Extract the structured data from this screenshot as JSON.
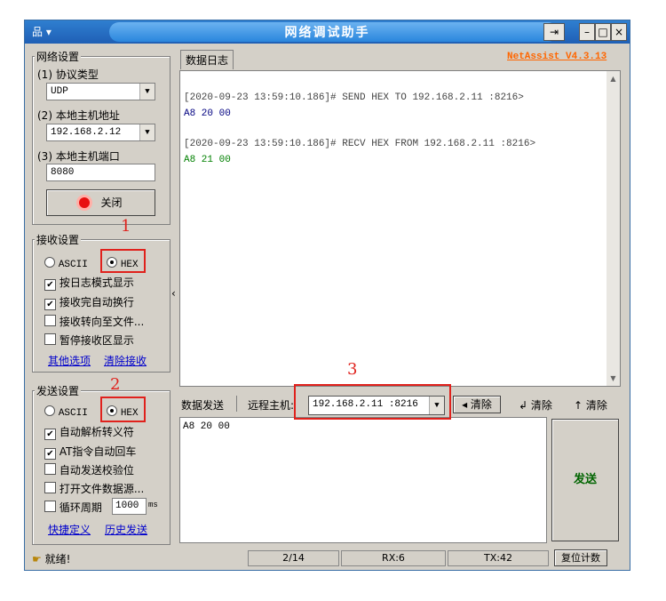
{
  "window": {
    "title": "网络调试助手",
    "version": "NetAssist V4.3.13",
    "menu_glyph": "品 ▾",
    "pin_glyph": "⇥",
    "minimize": "–",
    "maximize": "□",
    "close": "×"
  },
  "net_settings": {
    "group_label": "网络设置",
    "protocol_label": "(1) 协议类型",
    "protocol_value": "UDP",
    "host_label": "(2) 本地主机地址",
    "host_value": "192.168.2.12",
    "port_label": "(3) 本地主机端口",
    "port_value": "8080",
    "close_button": "关闭"
  },
  "recv_settings": {
    "group_label": "接收设置",
    "ascii_label": "ASCII",
    "hex_label": "HEX",
    "options": [
      "按日志模式显示",
      "接收完自动换行",
      "接收转向至文件...",
      "暂停接收区显示"
    ],
    "options_checked": [
      true,
      true,
      false,
      false
    ],
    "link_more": "其他选项",
    "link_clear": "清除接收"
  },
  "send_settings": {
    "group_label": "发送设置",
    "ascii_label": "ASCII",
    "hex_label": "HEX",
    "options": [
      "自动解析转义符",
      "AT指令自动回车",
      "自动发送校验位",
      "打开文件数据源...",
      "循环周期"
    ],
    "options_checked": [
      true,
      true,
      false,
      false,
      false
    ],
    "cycle_value": "1000",
    "cycle_unit": "ms",
    "link_shortcut": "快捷定义",
    "link_history": "历史发送"
  },
  "log": {
    "tab_label": "数据日志",
    "entries": [
      {
        "header": "[2020-09-23 13:59:10.186]# SEND HEX TO 192.168.2.11 :8216>",
        "data": "A8 20 00"
      },
      {
        "header": "[2020-09-23 13:59:10.186]# RECV HEX FROM 192.168.2.11 :8216>",
        "data": "A8 21 00"
      }
    ]
  },
  "send_bar": {
    "tab_label": "数据发送",
    "remote_label": "远程主机:",
    "remote_value": "192.168.2.11 :8216",
    "clear1": "清除",
    "clear2": "清除",
    "clear3": "清除",
    "send_text": "A8 20 00",
    "send_button": "发送"
  },
  "status": {
    "ready": "就绪!",
    "pages": "2/14",
    "rx": "RX:6",
    "tx": "TX:42",
    "reset": "复位计数"
  },
  "annotations": {
    "n1": "1",
    "n2": "2",
    "n3": "3"
  },
  "colors": {
    "title": "#1f5fb5",
    "send_data": "#000080",
    "recv_data": "#008000",
    "version": "#ff6600",
    "annotation": "#e0211c"
  }
}
